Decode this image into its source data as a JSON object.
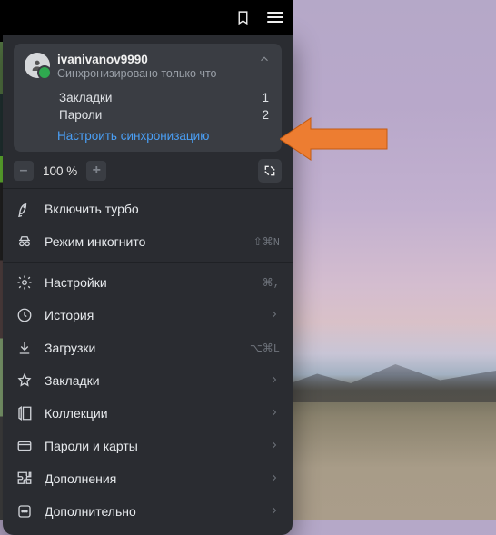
{
  "user": {
    "name": "ivanivanov9990",
    "status": "Синхронизировано только что"
  },
  "sync": {
    "rows": [
      {
        "label": "Закладки",
        "value": "1"
      },
      {
        "label": "Пароли",
        "value": "2"
      }
    ],
    "configure": "Настроить синхронизацию"
  },
  "zoom": {
    "minus": "–",
    "value": "100 %",
    "plus": "+"
  },
  "menu": {
    "turbo": {
      "label": "Включить турбо"
    },
    "incognito": {
      "label": "Режим инкогнито",
      "shortcut": "⇧⌘N"
    },
    "settings": {
      "label": "Настройки",
      "shortcut": "⌘,"
    },
    "history": {
      "label": "История"
    },
    "downloads": {
      "label": "Загрузки",
      "shortcut": "⌥⌘L"
    },
    "bookmarks": {
      "label": "Закладки"
    },
    "collections": {
      "label": "Коллекции"
    },
    "passwords": {
      "label": "Пароли и карты"
    },
    "addons": {
      "label": "Дополнения"
    },
    "more": {
      "label": "Дополнительно"
    }
  }
}
